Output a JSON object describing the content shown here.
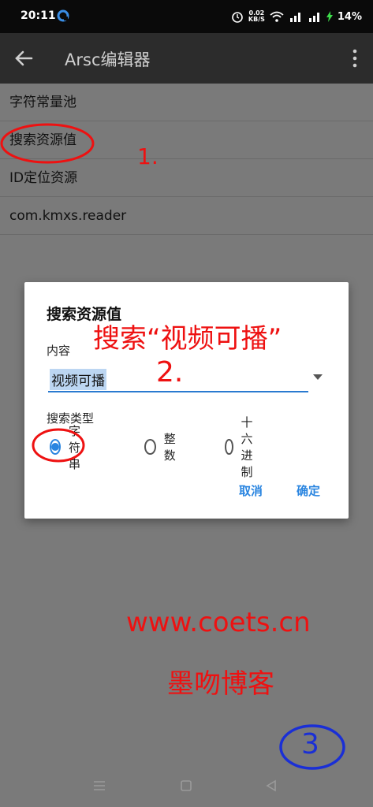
{
  "status_bar": {
    "time": "20:11",
    "net_speed_value": "0.02",
    "net_speed_unit": "KB/S",
    "battery_percent": "14%",
    "icons": [
      "alarm-icon",
      "wifi-icon",
      "signal-icon",
      "charging-icon"
    ]
  },
  "toolbar": {
    "title": "Arsc编辑器"
  },
  "list": {
    "items": [
      {
        "label": "字符常量池"
      },
      {
        "label": "搜索资源值"
      },
      {
        "label": "ID定位资源"
      },
      {
        "label": "com.kmxs.reader"
      }
    ]
  },
  "dialog": {
    "title": "搜索资源值",
    "content_label": "内容",
    "content_value": "视频可播",
    "search_type_label": "搜索类型",
    "options": [
      {
        "label": "字符串",
        "selected": true
      },
      {
        "label": "整数",
        "selected": false
      },
      {
        "label": "十六进制",
        "selected": false
      }
    ],
    "cancel_label": "取消",
    "confirm_label": "确定"
  },
  "annotations": {
    "step1": "1.",
    "step2": "2.",
    "step3": "3",
    "search_note": "搜索“视频可播”",
    "site": "www.coets.cn",
    "blog": "墨吻博客"
  },
  "colors": {
    "accent": "#2a85e0",
    "annotation_red": "#ee1111",
    "annotation_blue": "#1a2fd6",
    "overlay": "#7a7a7a",
    "toolbar": "#2c2c2c"
  }
}
